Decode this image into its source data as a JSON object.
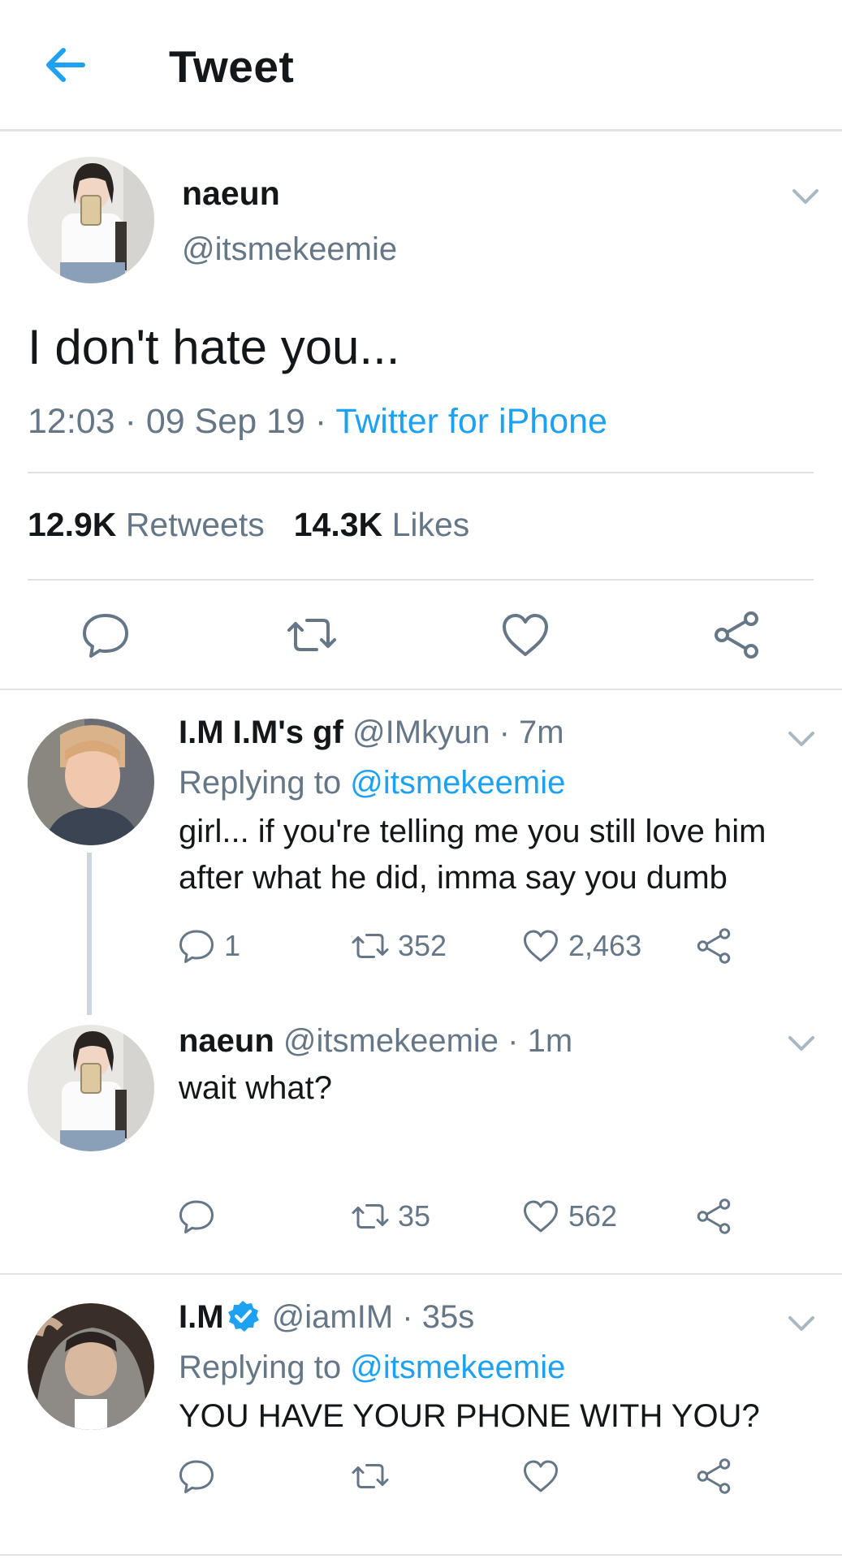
{
  "header": {
    "title": "Tweet"
  },
  "main_tweet": {
    "name": "naeun",
    "handle": "@itsmekeemie",
    "text": "I don't hate you...",
    "time": "12:03",
    "date": "09 Sep 19",
    "source": "Twitter for iPhone",
    "retweets_count": "12.9K",
    "retweets_label": "Retweets",
    "likes_count": "14.3K",
    "likes_label": "Likes",
    "sep": "·"
  },
  "replies": [
    {
      "name": "I.M I.M's gf",
      "handle": "@IMkyun",
      "age": "· 7m",
      "replying_label": "Replying to",
      "replying_to": "@itsmekeemie",
      "text": "girl... if you're telling me you still love him after what he did, imma say you dumb",
      "reply_count": "1",
      "retweet_count": "352",
      "like_count": "2,463"
    },
    {
      "name": "naeun",
      "handle": "@itsmekeemie",
      "age": "· 1m",
      "text": "wait what?",
      "reply_count": "",
      "retweet_count": "35",
      "like_count": "562"
    },
    {
      "name": "I.M",
      "handle": "@iamIM",
      "age": "· 35s",
      "verified": true,
      "replying_label": "Replying to",
      "replying_to": "@itsmekeemie",
      "text": "YOU HAVE YOUR PHONE WITH YOU?",
      "reply_count": "",
      "retweet_count": "",
      "like_count": ""
    }
  ],
  "colors": {
    "accent": "#1da1f2",
    "secondary_text": "#657786",
    "primary_text": "#14171a",
    "divider": "#dfe3e6"
  },
  "icons": [
    "back-arrow-icon",
    "chevron-down-icon",
    "reply-icon",
    "retweet-icon",
    "like-icon",
    "share-icon",
    "verified-icon"
  ]
}
